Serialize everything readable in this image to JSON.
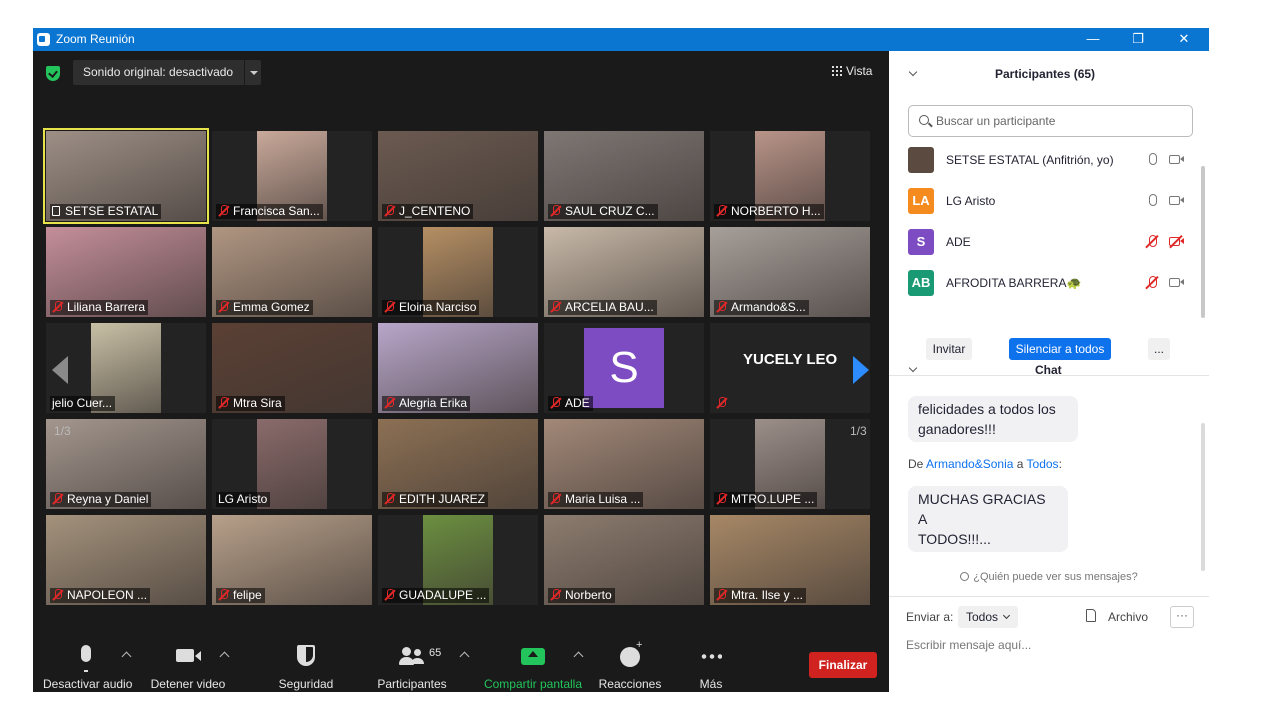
{
  "window": {
    "title": "Zoom Reunión",
    "minimize": "—",
    "restore": "❐",
    "close": "✕"
  },
  "top_bar": {
    "sound": "Sonido original: desactivado",
    "view": "Vista"
  },
  "grid": {
    "page_left": "1/3",
    "page_right": "1/3",
    "tiles": [
      {
        "name": "SETSE ESTATAL",
        "muted": false,
        "photo": "#9d8f86"
      },
      {
        "name": "Francisca San...",
        "muted": true,
        "photo": "#c9a99a"
      },
      {
        "name": "J_CENTENO",
        "muted": true,
        "photo": "#6b5a50"
      },
      {
        "name": "SAUL CRUZ C...",
        "muted": true,
        "photo": "#7e7774"
      },
      {
        "name": "NORBERTO H...",
        "muted": true,
        "photo": "#b99488"
      },
      {
        "name": "Liliana Barrera",
        "muted": true,
        "photo": "#c48e9a"
      },
      {
        "name": "Emma Gomez",
        "muted": true,
        "photo": "#b09682"
      },
      {
        "name": "Eloina Narciso",
        "muted": true,
        "photo": "#b58f63"
      },
      {
        "name": "ARCELIA BAU...",
        "muted": true,
        "photo": "#c8b9a8"
      },
      {
        "name": "Armando&S...",
        "muted": true,
        "photo": "#a69f9a"
      },
      {
        "name": "jelio Cuer...",
        "muted": false,
        "photo": "#c8c0a5"
      },
      {
        "name": "Mtra Sira",
        "muted": true,
        "photo": "#5b4034"
      },
      {
        "name": "Alegria Erika",
        "muted": true,
        "photo": "#b8a6c9"
      },
      {
        "name": "ADE",
        "muted": true,
        "photo": "avatar"
      },
      {
        "name": "",
        "muted": true,
        "photo": "text",
        "big_name": "YUCELY LEO"
      },
      {
        "name": "Reyna y Daniel",
        "muted": true,
        "photo": "#a3968e"
      },
      {
        "name": "LG Aristo",
        "muted": false,
        "photo": "#8a6b6b"
      },
      {
        "name": "EDITH JUAREZ",
        "muted": true,
        "photo": "#8c7054"
      },
      {
        "name": "Maria Luisa ...",
        "muted": true,
        "photo": "#a28878"
      },
      {
        "name": "MTRO.LUPE ...",
        "muted": true,
        "photo": "#9c8f8a"
      },
      {
        "name": "NAPOLEON ...",
        "muted": true,
        "photo": "#a4927c"
      },
      {
        "name": "felipe",
        "muted": true,
        "photo": "#b7a08a"
      },
      {
        "name": "GUADALUPE ...",
        "muted": true,
        "photo": "#6b8f40"
      },
      {
        "name": "Norberto",
        "muted": true,
        "photo": "#8d7c6f"
      },
      {
        "name": "Mtra. Ilse y ...",
        "muted": true,
        "photo": "#a78866"
      }
    ],
    "avatar_letter": "S"
  },
  "toolbar": {
    "audio": "Desactivar audio",
    "video": "Detener video",
    "security": "Seguridad",
    "participants": "Participantes",
    "participants_count": "65",
    "share": "Compartir pantalla",
    "reactions": "Reacciones",
    "more": "Más",
    "end": "Finalizar"
  },
  "participants_panel": {
    "title": "Participantes (65)",
    "search_placeholder": "Buscar un participante",
    "list": [
      {
        "name": "SETSE ESTATAL (Anfitrión, yo)",
        "initials": "",
        "color": "#5a4a3f",
        "mic_off": false,
        "cam_off": false
      },
      {
        "name": "LG Aristo",
        "initials": "LA",
        "color": "#f58a1f",
        "mic_off": false,
        "cam_off": false
      },
      {
        "name": "ADE",
        "initials": "S",
        "color": "#7d4bc2",
        "mic_off": true,
        "cam_off": true
      },
      {
        "name": "AFRODITA  BARRERA🐢",
        "initials": "AB",
        "color": "#1a9a74",
        "mic_off": true,
        "cam_off": false
      }
    ],
    "invite": "Invitar",
    "mute_all": "Silenciar a todos",
    "more": "..."
  },
  "chat": {
    "title": "Chat",
    "messages": [
      {
        "text_line1": "felicidades a todos los",
        "text_line2": "ganadores!!!"
      },
      {
        "from_prefix": "De ",
        "from": "Armando&Sonia",
        "mid": " a ",
        "to": "Todos",
        "suffix": ":",
        "text_line1": "MUCHAS GRACIAS A",
        "text_line2": "TODOS!!!..."
      }
    ],
    "who_can_see": "¿Quién puede ver sus mensajes?",
    "send_to_label": "Enviar a:",
    "send_to_value": "Todos",
    "file_label": "Archivo",
    "more": "···",
    "placeholder": "Escribir mensaje aquí..."
  }
}
